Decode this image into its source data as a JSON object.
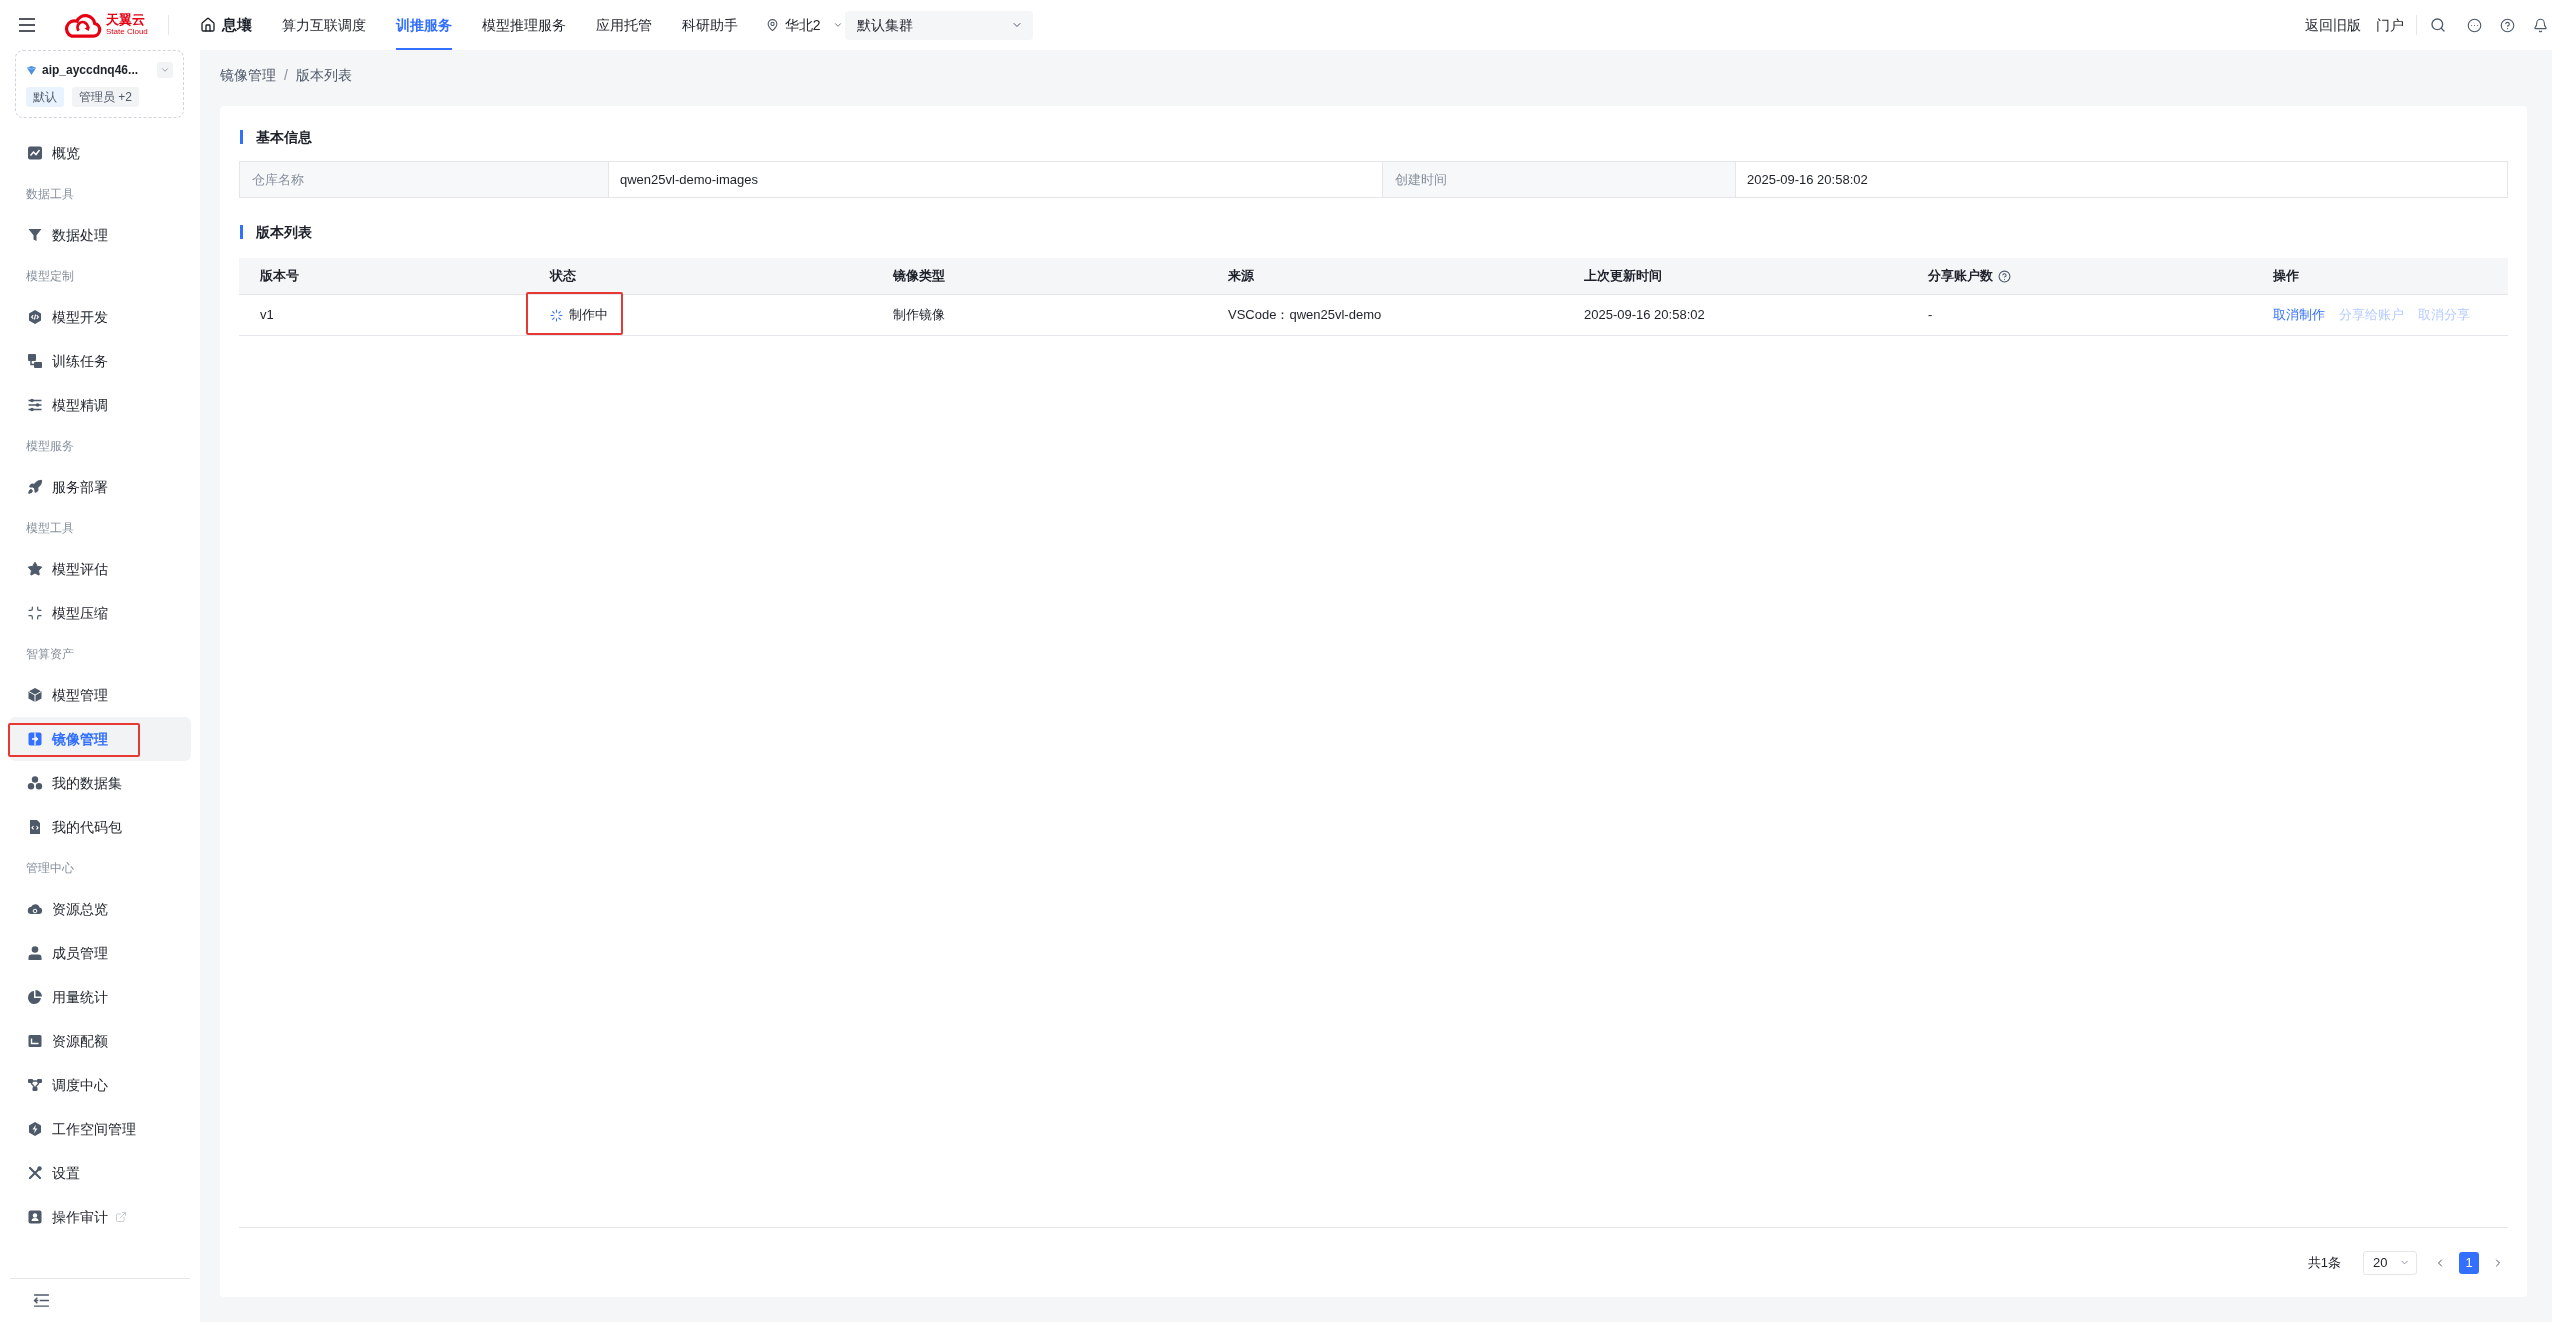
{
  "top_bar": {
    "brand": {
      "name": "天翼云",
      "subtitle": "State Cloud"
    },
    "home": "息壤",
    "nav": [
      {
        "label": "算力互联调度",
        "selected": false
      },
      {
        "label": "训推服务",
        "selected": true
      },
      {
        "label": "模型推理服务",
        "selected": false
      },
      {
        "label": "应用托管",
        "selected": false
      },
      {
        "label": "科研助手",
        "selected": false
      }
    ],
    "region": "华北2",
    "cluster": "默认集群",
    "links": [
      "返回旧版",
      "门户"
    ]
  },
  "workspace": {
    "name": "aip_ayccdnq46...",
    "tags": [
      {
        "label": "默认",
        "kind": "primary"
      },
      {
        "label": "管理员 +2",
        "kind": "neutral"
      }
    ]
  },
  "sidebar": {
    "items": [
      {
        "kind": "item",
        "label": "概览",
        "selected": false,
        "highlighted": false,
        "external": false
      },
      {
        "kind": "section",
        "label": "数据工具"
      },
      {
        "kind": "item",
        "label": "数据处理",
        "selected": false,
        "highlighted": false,
        "external": false
      },
      {
        "kind": "section",
        "label": "模型定制"
      },
      {
        "kind": "item",
        "label": "模型开发",
        "selected": false,
        "highlighted": false,
        "external": false
      },
      {
        "kind": "item",
        "label": "训练任务",
        "selected": false,
        "highlighted": false,
        "external": false
      },
      {
        "kind": "item",
        "label": "模型精调",
        "selected": false,
        "highlighted": false,
        "external": false
      },
      {
        "kind": "section",
        "label": "模型服务"
      },
      {
        "kind": "item",
        "label": "服务部署",
        "selected": false,
        "highlighted": false,
        "external": false
      },
      {
        "kind": "section",
        "label": "模型工具"
      },
      {
        "kind": "item",
        "label": "模型评估",
        "selected": false,
        "highlighted": false,
        "external": false
      },
      {
        "kind": "item",
        "label": "模型压缩",
        "selected": false,
        "highlighted": false,
        "external": false
      },
      {
        "kind": "section",
        "label": "智算资产"
      },
      {
        "kind": "item",
        "label": "模型管理",
        "selected": false,
        "highlighted": false,
        "external": false
      },
      {
        "kind": "item",
        "label": "镜像管理",
        "selected": true,
        "highlighted": true,
        "external": false
      },
      {
        "kind": "item",
        "label": "我的数据集",
        "selected": false,
        "highlighted": false,
        "external": false
      },
      {
        "kind": "item",
        "label": "我的代码包",
        "selected": false,
        "highlighted": false,
        "external": false
      },
      {
        "kind": "section",
        "label": "管理中心"
      },
      {
        "kind": "item",
        "label": "资源总览",
        "selected": false,
        "highlighted": false,
        "external": false
      },
      {
        "kind": "item",
        "label": "成员管理",
        "selected": false,
        "highlighted": false,
        "external": false
      },
      {
        "kind": "item",
        "label": "用量统计",
        "selected": false,
        "highlighted": false,
        "external": false
      },
      {
        "kind": "item",
        "label": "资源配额",
        "selected": false,
        "highlighted": false,
        "external": false
      },
      {
        "kind": "item",
        "label": "调度中心",
        "selected": false,
        "highlighted": false,
        "external": false
      },
      {
        "kind": "item",
        "label": "工作空间管理",
        "selected": false,
        "highlighted": false,
        "external": false
      },
      {
        "kind": "item",
        "label": "设置",
        "selected": false,
        "highlighted": false,
        "external": false
      },
      {
        "kind": "item",
        "label": "操作审计",
        "selected": false,
        "highlighted": false,
        "external": true
      }
    ]
  },
  "breadcrumb": {
    "items": [
      "镜像管理",
      "版本列表"
    ],
    "separator": "/"
  },
  "basic_info": {
    "title": "基本信息",
    "fields": [
      {
        "label": "仓库名称",
        "value": "qwen25vl-demo-images"
      },
      {
        "label": "创建时间",
        "value": "2025-09-16 20:58:02"
      }
    ]
  },
  "versions": {
    "title": "版本列表",
    "columns": [
      {
        "label": "版本号",
        "help": false
      },
      {
        "label": "状态",
        "help": false
      },
      {
        "label": "镜像类型",
        "help": false
      },
      {
        "label": "来源",
        "help": false
      },
      {
        "label": "上次更新时间",
        "help": false
      },
      {
        "label": "分享账户数",
        "help": true
      },
      {
        "label": "操作",
        "help": false
      }
    ],
    "rows": [
      {
        "version": "v1",
        "status": {
          "label": "制作中",
          "kind": "processing"
        },
        "highlighted": true,
        "type": "制作镜像",
        "source": "VSCode：qwen25vl-demo",
        "updated": "2025-09-16 20:58:02",
        "shares": "-",
        "actions": [
          {
            "label": "取消制作",
            "disabled": false
          },
          {
            "label": "分享给账户",
            "disabled": true
          },
          {
            "label": "取消分享",
            "disabled": true
          }
        ]
      }
    ]
  },
  "pagination": {
    "total": "共1条",
    "page_size": "20",
    "pages": [
      {
        "label": "1",
        "selected": true
      }
    ]
  }
}
